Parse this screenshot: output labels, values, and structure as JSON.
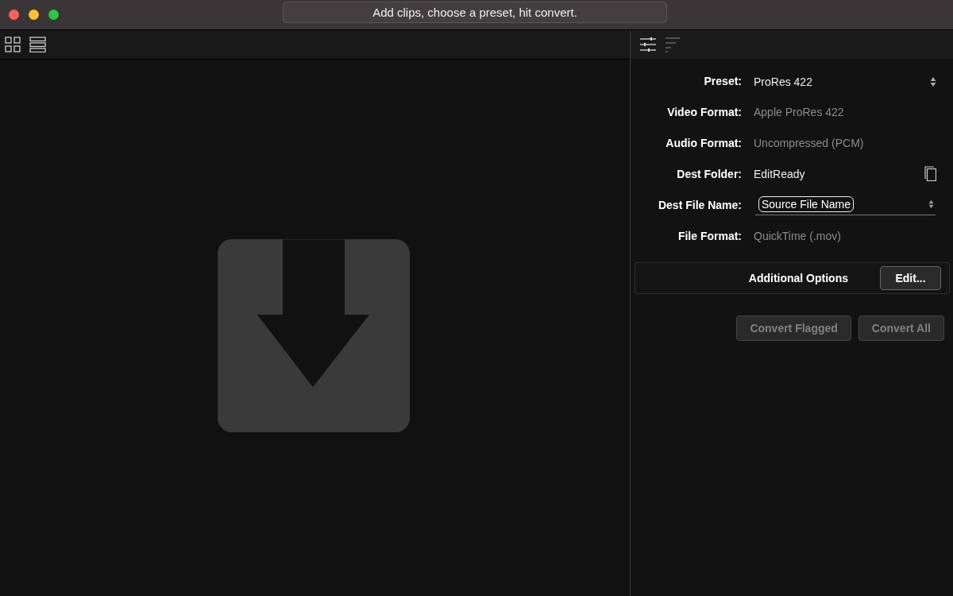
{
  "window": {
    "title": "Add clips, choose a preset, hit convert."
  },
  "settings": {
    "fields": [
      {
        "label": "Preset:",
        "value": "ProRes 422",
        "kind": "popup"
      },
      {
        "label": "Video Format:",
        "value": "Apple ProRes 422",
        "kind": "static"
      },
      {
        "label": "Audio Format:",
        "value": "Uncompressed (PCM)",
        "kind": "static"
      },
      {
        "label": "Dest Folder:",
        "value": "EditReady",
        "kind": "folder"
      },
      {
        "label": "Dest File Name:",
        "value": "Source File Name",
        "kind": "token"
      },
      {
        "label": "File Format:",
        "value": "QuickTime (.mov)",
        "kind": "static"
      }
    ],
    "additional_options": {
      "label": "Additional Options",
      "button": "Edit..."
    },
    "actions": [
      {
        "label": "Convert Flagged",
        "disabled": true
      },
      {
        "label": "Convert All",
        "disabled": true
      }
    ]
  }
}
